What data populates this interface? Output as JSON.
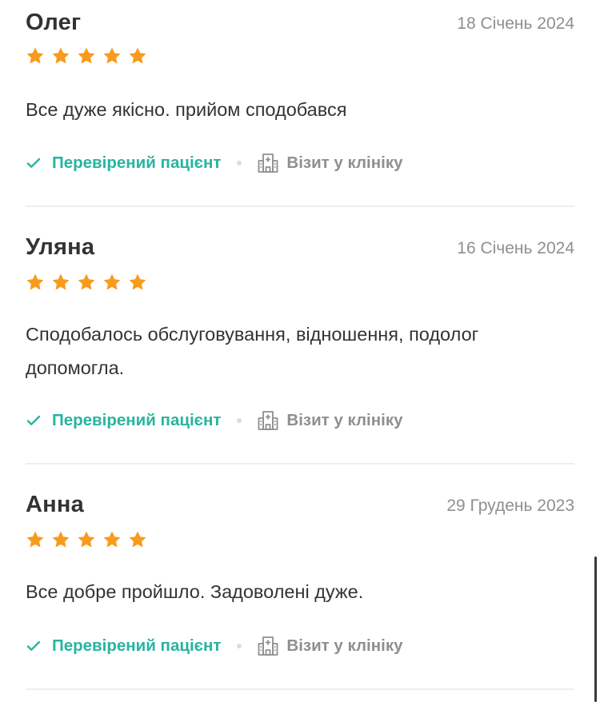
{
  "reviews": [
    {
      "name": "Олег",
      "date": "18 Січень 2024",
      "rating": 5,
      "text": "Все дуже якісно. прийом сподобався",
      "verified_label": "Перевірений пацієнт",
      "visit_label": "Візит у клініку"
    },
    {
      "name": "Уляна",
      "date": "16 Січень 2024",
      "rating": 5,
      "text": "Сподобалось обслуговування, відношення, подолог допомогла.",
      "verified_label": "Перевірений пацієнт",
      "visit_label": "Візит у клініку"
    },
    {
      "name": "Анна",
      "date": "29 Грудень 2023",
      "rating": 5,
      "text": "Все добре пройшло. Задоволені дуже.",
      "verified_label": "Перевірений пацієнт",
      "visit_label": "Візит у клініку"
    }
  ],
  "colors": {
    "star": "#f89b1c",
    "verified": "#28b4a0",
    "muted": "#8f8f8f",
    "divider": "#eceef1"
  },
  "icons": {
    "star": "star-icon",
    "check": "check-icon",
    "clinic": "clinic-building-icon"
  }
}
